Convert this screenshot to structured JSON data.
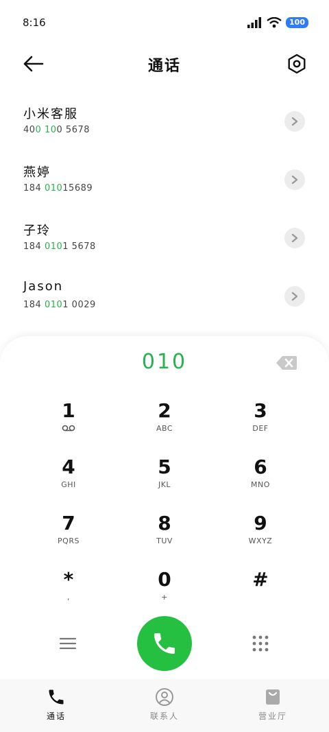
{
  "status": {
    "time": "8:16",
    "battery": "100"
  },
  "header": {
    "title": "通话"
  },
  "results": [
    {
      "name": "小米客服",
      "num_pre": "40",
      "num_hl": "0",
      "num_mid": " ",
      "num_hl2": "10",
      "num_post": "0 5678"
    },
    {
      "name": "燕婷",
      "num_pre": "184 ",
      "num_hl": "010",
      "num_mid": "",
      "num_hl2": "",
      "num_post": "15689"
    },
    {
      "name": "子玲",
      "num_pre": "184 ",
      "num_hl": "010",
      "num_mid": "",
      "num_hl2": "",
      "num_post": "1 5678"
    },
    {
      "name": "Jason",
      "num_pre": "184 ",
      "num_hl": "010",
      "num_mid": "",
      "num_hl2": "",
      "num_post": "1 0029"
    }
  ],
  "dialer": {
    "display": "010",
    "keys": [
      {
        "digit": "1",
        "letters": ""
      },
      {
        "digit": "2",
        "letters": "ABC"
      },
      {
        "digit": "3",
        "letters": "DEF"
      },
      {
        "digit": "4",
        "letters": "GHI"
      },
      {
        "digit": "5",
        "letters": "JKL"
      },
      {
        "digit": "6",
        "letters": "MNO"
      },
      {
        "digit": "7",
        "letters": "PQRS"
      },
      {
        "digit": "8",
        "letters": "TUV"
      },
      {
        "digit": "9",
        "letters": "WXYZ"
      },
      {
        "digit": "*",
        "letters": ","
      },
      {
        "digit": "0",
        "letters": "+"
      },
      {
        "digit": "#",
        "letters": ""
      }
    ]
  },
  "tabs": [
    {
      "label": "通话",
      "icon": "phone-icon",
      "active": true
    },
    {
      "label": "联系人",
      "icon": "contacts-icon",
      "active": false
    },
    {
      "label": "营业厅",
      "icon": "store-icon",
      "active": false
    }
  ],
  "colors": {
    "accent": "#25b34b",
    "call": "#25c042",
    "battery": "#2f7cf6"
  }
}
